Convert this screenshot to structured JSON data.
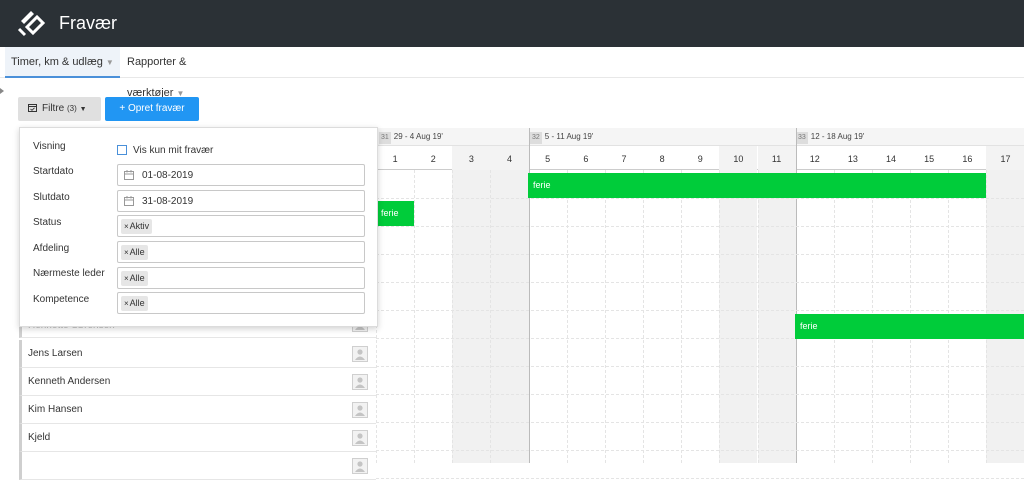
{
  "app": {
    "title": "Fravær"
  },
  "nav": {
    "tabs": [
      {
        "label": "Timer, km & udlæg",
        "active": true
      },
      {
        "label": "Rapporter & værktøjer",
        "active": false
      }
    ]
  },
  "toolbar": {
    "filter_label": "Filtre",
    "filter_count": "(3)",
    "create_label": "+ Opret fravær"
  },
  "filter_panel": {
    "visning_label": "Visning",
    "only_mine_label": "Vis kun mit fravær",
    "startdato_label": "Startdato",
    "startdato_value": "01-08-2019",
    "slutdato_label": "Slutdato",
    "slutdato_value": "31-08-2019",
    "status_label": "Status",
    "status_tag": "Aktiv",
    "afdeling_label": "Afdeling",
    "afdeling_tag": "Alle",
    "leder_label": "Nærmeste leder",
    "leder_tag": "Alle",
    "kompetence_label": "Kompetence",
    "kompetence_tag": "Alle",
    "tag_remove_glyph": "×"
  },
  "calendar": {
    "weeks": [
      {
        "num": "31",
        "range": "29 - 4 Aug 19'"
      },
      {
        "num": "32",
        "range": "5 - 11 Aug 19'"
      },
      {
        "num": "33",
        "range": "12 - 18 Aug 19'"
      }
    ],
    "days": [
      "1",
      "2",
      "3",
      "4",
      "5",
      "6",
      "7",
      "8",
      "9",
      "10",
      "11",
      "12",
      "13",
      "14",
      "15",
      "16",
      "17"
    ],
    "weekend_days": [
      "3",
      "4",
      "10",
      "11",
      "17"
    ],
    "absences": [
      {
        "label": "ferie"
      },
      {
        "label": "ferie"
      },
      {
        "label": "ferie"
      }
    ],
    "absence_color": "#00cc3a"
  },
  "employees": [
    {
      "name": "Henriette Sørensen"
    },
    {
      "name": "Jens Larsen"
    },
    {
      "name": "Kenneth Andersen"
    },
    {
      "name": "Kim Hansen"
    },
    {
      "name": "Kjeld"
    }
  ],
  "colors": {
    "topbar": "#2b3136",
    "primary": "#2196f3"
  },
  "icons": [
    "logo-icon",
    "calendar-filter-icon",
    "caret-down-icon",
    "calendar-icon",
    "avatar-icon",
    "checkbox-icon"
  ]
}
